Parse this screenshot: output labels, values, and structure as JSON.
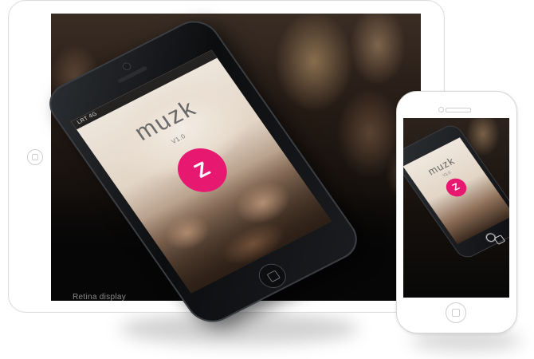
{
  "tablet": {
    "caption": "Retina display"
  },
  "big_phone": {
    "status_bar": "LRT 4G",
    "app_title": "muzk",
    "app_version": "V1.0",
    "logo_letter": "Z",
    "logo_color": "#e6186f"
  },
  "small_phone": {
    "app_title": "muzk",
    "app_version": "V1.0",
    "logo_letter": "Z"
  }
}
